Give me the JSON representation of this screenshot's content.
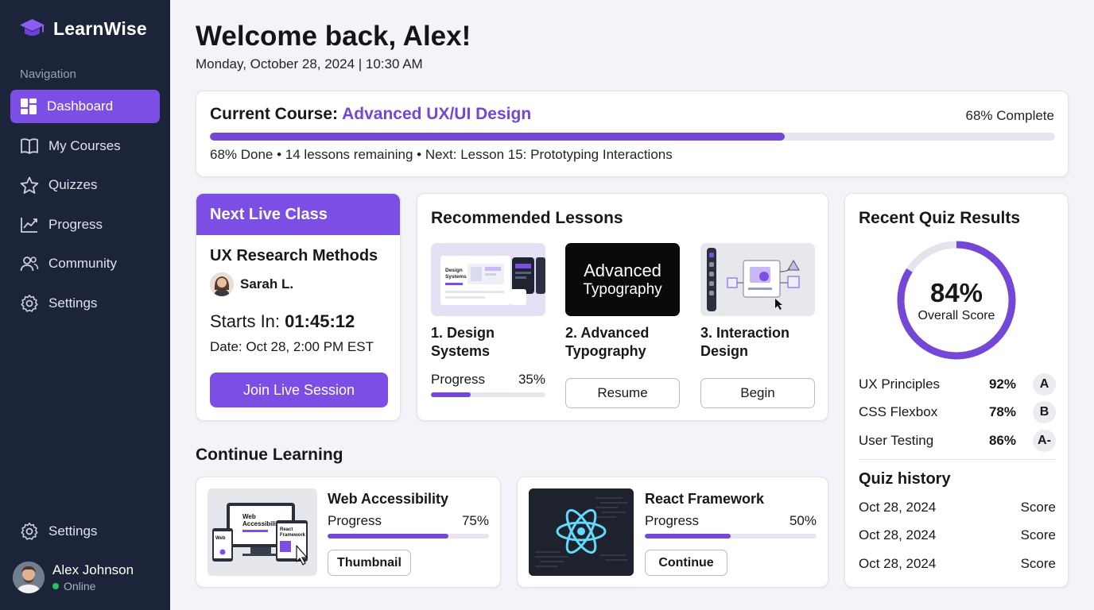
{
  "brand": {
    "name": "LearnWise"
  },
  "sidebar": {
    "heading": "Navigation",
    "items": [
      {
        "label": "Dashboard",
        "icon": "dashboard-icon",
        "active": true
      },
      {
        "label": "My Courses",
        "icon": "book-icon"
      },
      {
        "label": "Quizzes",
        "icon": "star-icon"
      },
      {
        "label": "Progress",
        "icon": "chart-icon"
      },
      {
        "label": "Community",
        "icon": "users-icon"
      },
      {
        "label": "Settings",
        "icon": "gear-icon"
      }
    ],
    "bottom_settings": "Settings",
    "user": {
      "name": "Alex Johnson",
      "status": "Online"
    }
  },
  "header": {
    "welcome": "Welcome back, Alex!",
    "datetime": "Monday, October 28, 2024 | 10:30 AM"
  },
  "current_course": {
    "label": "Current Course:",
    "name": "Advanced UX/UI Design",
    "percent_text": "68% Complete",
    "progress": 0.68,
    "subtitle": "68% Done • 14 lessons remaining • Next: Lesson 15: Prototyping Interactions"
  },
  "live_class": {
    "header": "Next Live Class",
    "title": "UX Research Methods",
    "instructor": "Sarah L.",
    "starts_label": "Starts In:",
    "countdown": "01:45:12",
    "date": "Date: Oct 28, 2:00 PM EST",
    "button": "Join Live Session"
  },
  "recommended": {
    "title": "Recommended Lessons",
    "lessons": [
      {
        "title": "1. Design Systems",
        "thumb_text_1": "Design",
        "thumb_text_2": "Systems",
        "progress_label": "Progress",
        "progress_text": "35%",
        "progress": 0.35
      },
      {
        "title": "2. Advanced Typography",
        "thumb_text_1": "Advanced",
        "thumb_text_2": "Typography",
        "button": "Resume"
      },
      {
        "title": "3. Interaction Design",
        "button": "Begin"
      }
    ]
  },
  "continue": {
    "title": "Continue Learning",
    "items": [
      {
        "title": "Web Accessibility",
        "progress_label": "Progress",
        "progress_text": "75%",
        "progress": 0.75,
        "button": "Thumbnail",
        "thumb_text_1": "Web",
        "thumb_text_2": "Accessibili",
        "thumb_text_3": "React",
        "thumb_text_4": "Framework"
      },
      {
        "title": "React Framework",
        "progress_label": "Progress",
        "progress_text": "50%",
        "progress": 0.5,
        "button": "Continue"
      }
    ]
  },
  "quiz": {
    "title": "Recent Quiz Results",
    "overall_text": "84%",
    "overall_value": 0.84,
    "overall_label": "Overall Score",
    "results": [
      {
        "subject": "UX Principles",
        "score": "92%",
        "grade": "A"
      },
      {
        "subject": "CSS Flexbox",
        "score": "78%",
        "grade": "B"
      },
      {
        "subject": "User Testing",
        "score": "86%",
        "grade": "A-"
      }
    ],
    "history_title": "Quiz history",
    "history": [
      {
        "date": "Oct 28, 2024",
        "label": "Score"
      },
      {
        "date": "Oct 28, 2024",
        "label": "Score"
      },
      {
        "date": "Oct 28, 2024",
        "label": "Score"
      }
    ]
  },
  "colors": {
    "accent": "#7c4ee4",
    "sidebar_bg": "#1b2438",
    "page_bg": "#f3f4f8",
    "online": "#22c55e"
  }
}
